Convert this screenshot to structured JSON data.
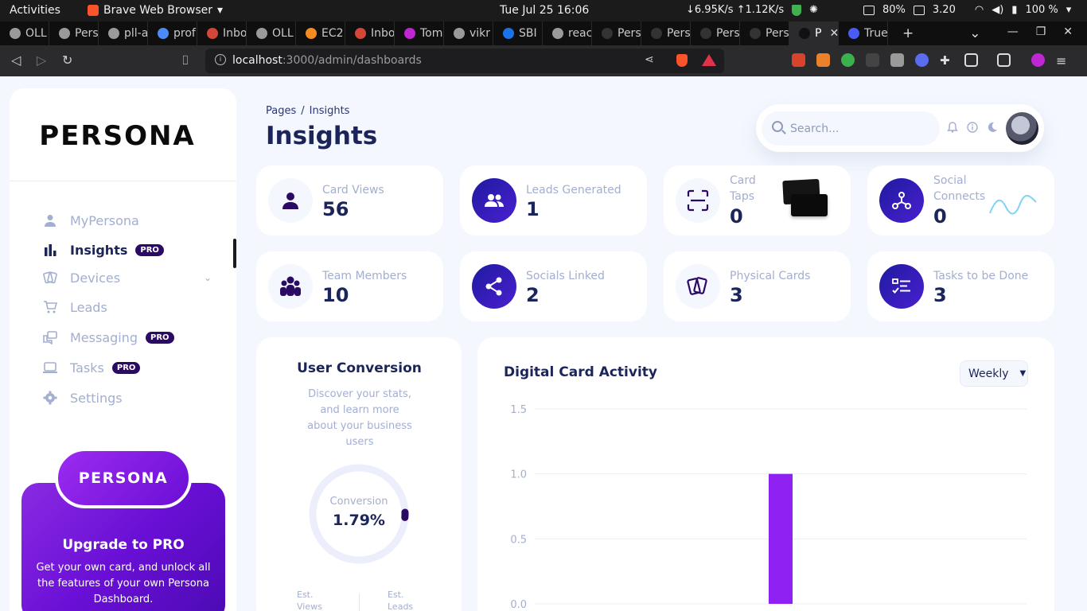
{
  "os": {
    "activities": "Activities",
    "app_name": "Brave Web Browser",
    "clock": "Tue Jul 25  16:06",
    "net": "↓6.95K/s ↑1.12K/s",
    "mem": "80%",
    "load": "3.20",
    "battery": "100 %"
  },
  "browser": {
    "tabs": [
      {
        "label": "OLL",
        "color": "#9a9a9a"
      },
      {
        "label": "Pers",
        "color": "#9a9a9a"
      },
      {
        "label": "pll-a",
        "color": "#9a9a9a"
      },
      {
        "label": "prof",
        "color": "#4c8bf5"
      },
      {
        "label": "Inbo",
        "color": "#d44638"
      },
      {
        "label": "OLL",
        "color": "#9a9a9a"
      },
      {
        "label": "EC2",
        "color": "#f68b1f"
      },
      {
        "label": "Inbo",
        "color": "#d44638"
      },
      {
        "label": "Tom",
        "color": "#c026d3"
      },
      {
        "label": "vikr",
        "color": "#9a9a9a"
      },
      {
        "label": "SBI",
        "color": "#1a73e8"
      },
      {
        "label": "reac",
        "color": "#9a9a9a"
      },
      {
        "label": "Pers",
        "color": "#333333"
      },
      {
        "label": "Pers",
        "color": "#333333"
      },
      {
        "label": "Pers",
        "color": "#333333"
      },
      {
        "label": "Pers",
        "color": "#333333"
      },
      {
        "label": "P",
        "color": "#111111"
      },
      {
        "label": "True",
        "color": "#4b5cf6"
      }
    ],
    "active_tab_close": "✕",
    "url_host": "localhost",
    "url_path": ":3000/admin/dashboards"
  },
  "sidebar": {
    "brand": "PERSONA",
    "items": [
      {
        "label": "MyPersona",
        "pro": ""
      },
      {
        "label": "Insights",
        "pro": "PRO"
      },
      {
        "label": "Devices",
        "pro": ""
      },
      {
        "label": "Leads",
        "pro": ""
      },
      {
        "label": "Messaging",
        "pro": "PRO"
      },
      {
        "label": "Tasks",
        "pro": "PRO"
      },
      {
        "label": "Settings",
        "pro": ""
      }
    ],
    "promo": {
      "badge": "PERSONA",
      "title": "Upgrade to PRO",
      "text": "Get your own card, and unlock all the features of your own Persona Dashboard."
    }
  },
  "header": {
    "breadcrumb_root": "Pages",
    "breadcrumb_sep": "/",
    "breadcrumb_current": "Insights",
    "title": "Insights",
    "search_placeholder": "Search..."
  },
  "stats": [
    {
      "label": "Card Views",
      "value": "56"
    },
    {
      "label": "Leads Generated",
      "value": "1"
    },
    {
      "label": "Card Taps",
      "value": "0"
    },
    {
      "label": "Social Connects",
      "value": "0"
    },
    {
      "label": "Team Members",
      "value": "10"
    },
    {
      "label": "Socials Linked",
      "value": "2"
    },
    {
      "label": "Physical Cards",
      "value": "3"
    },
    {
      "label": "Tasks to be Done",
      "value": "3"
    }
  ],
  "conversion": {
    "title": "User Conversion",
    "description": "Discover your stats, and learn more about your business users",
    "label": "Conversion",
    "value": "1.79%",
    "percent": 1.79,
    "est_views": "Est. Views",
    "est_leads": "Est. Leads"
  },
  "activity": {
    "title": "Digital Card Activity",
    "period": "Weekly"
  },
  "chart_data": {
    "type": "bar",
    "title": "Digital Card Activity",
    "y_ticks": [
      "1.5",
      "1.0",
      "0.5",
      "0.0"
    ],
    "ylim": [
      0,
      1.5
    ],
    "values": [
      0,
      0,
      0,
      1,
      0,
      0,
      0
    ],
    "color": "#8f22f2",
    "grid": true
  },
  "colors": {
    "accent": "#4318ff",
    "navy": "#1b2559",
    "muted": "#a3aed0",
    "purple": "#8f22f2"
  }
}
